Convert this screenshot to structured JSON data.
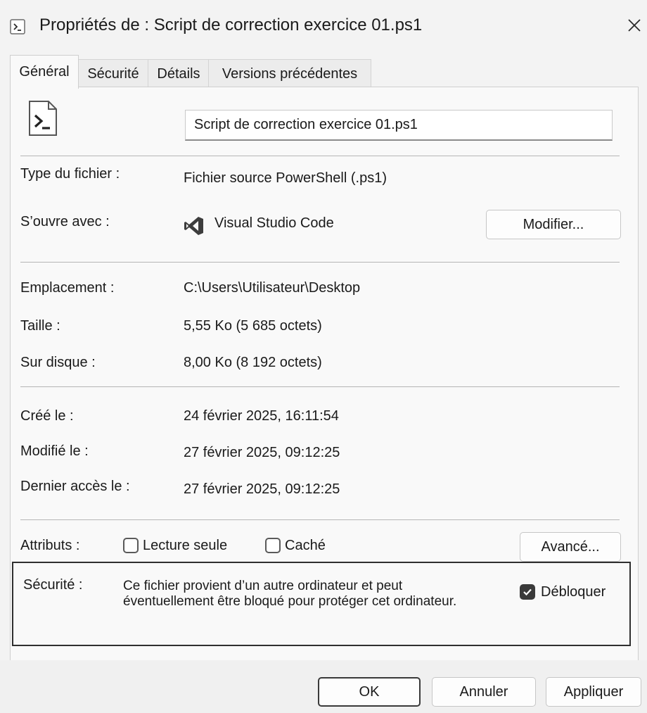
{
  "window": {
    "title": "Propriétés de : Script de correction exercice 01.ps1",
    "title_icon": "powershell-icon",
    "close_glyph": "✕"
  },
  "tabs": [
    {
      "label": "Général",
      "active": true
    },
    {
      "label": "Sécurité",
      "active": false
    },
    {
      "label": "Détails",
      "active": false
    },
    {
      "label": "Versions précédentes",
      "active": false
    }
  ],
  "general": {
    "file_icon": "powershell-file-icon",
    "file_name": "Script de correction exercice 01.ps1",
    "type_label": "Type du fichier :",
    "type_value": "Fichier source PowerShell (.ps1)",
    "opens_with_label": "S’ouvre avec :",
    "opens_with_app": "Visual Studio Code",
    "opens_with_icon": "vscode-icon",
    "change_button": "Modifier...",
    "location_label": "Emplacement :",
    "location_value": "C:\\Users\\Utilisateur\\Desktop",
    "size_label": "Taille :",
    "size_value": "5,55 Ko (5 685 octets)",
    "disk_label": "Sur disque :",
    "disk_value": "8,00 Ko (8 192 octets)",
    "created_label": "Créé le :",
    "created_value": "24 février 2025, 16:11:54",
    "modified_label": "Modifié le :",
    "modified_value": "27 février 2025, 09:12:25",
    "accessed_label": "Dernier accès le :",
    "accessed_value": "27 février 2025, 09:12:25",
    "attributes_label": "Attributs :",
    "readonly_label": "Lecture seule",
    "readonly_checked": false,
    "hidden_label": "Caché",
    "hidden_checked": false,
    "advanced_button": "Avancé...",
    "security_label": "Sécurité :",
    "security_line1": "Ce fichier provient d’un autre ordinateur et peut",
    "security_line2": "éventuellement être bloqué pour protéger cet ordinateur.",
    "unblock_label": "Débloquer",
    "unblock_checked": true
  },
  "footer": {
    "ok": "OK",
    "cancel": "Annuler",
    "apply": "Appliquer"
  },
  "colors": {
    "window_bg": "#f3f3f3",
    "panel_bg": "#f9f9f9",
    "text": "#1a1a1a",
    "checkbox_checked": "#3a3a3a"
  }
}
